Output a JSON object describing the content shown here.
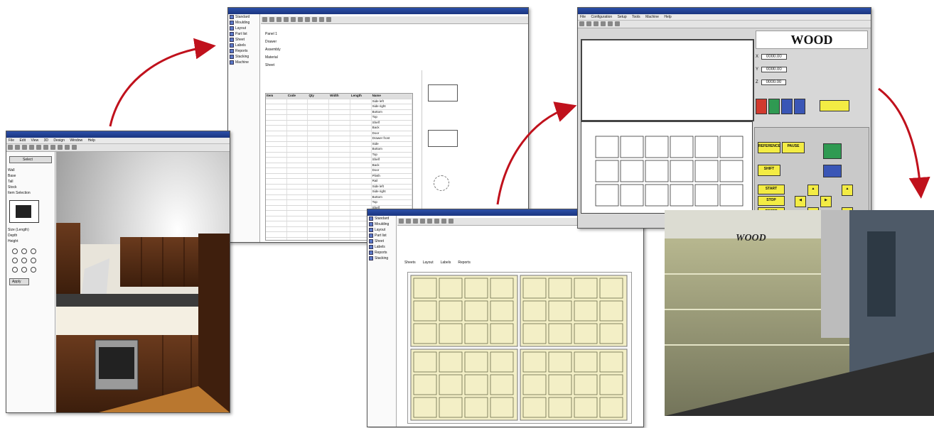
{
  "kitchen_window": {
    "menu": [
      "File",
      "Edit",
      "View",
      "3D",
      "Design",
      "Window",
      "Help"
    ],
    "side_labels": [
      "Wall",
      "Base",
      "Tall",
      "Stock",
      "Item Selection"
    ],
    "props": [
      "Size (Length)",
      "Depth",
      "Height"
    ],
    "buttons": [
      "Select",
      "Apply"
    ]
  },
  "parts_window": {
    "nav": [
      "Standard",
      "Moulding",
      "Layout",
      "Part list",
      "Sheet",
      "Labels",
      "Reports",
      "Stacking",
      "Machine"
    ],
    "fields": [
      "Panel 1",
      "Drawer",
      "Assembly",
      "Material",
      "Sheet"
    ],
    "table_headers": [
      "Item",
      "Code",
      "Qty",
      "Width",
      "Length",
      "Name"
    ],
    "row_names": [
      "Side left",
      "Side right",
      "Bottom",
      "Top",
      "Shelf",
      "Back",
      "Door",
      "Drawer front",
      "Side",
      "Bottom",
      "Top",
      "Shelf",
      "Back",
      "Door",
      "Plinth",
      "Rail",
      "Side left",
      "Side right",
      "Bottom",
      "Top",
      "Shelf",
      "Back",
      "Door",
      "Drawer front",
      "Side",
      "Bottom",
      "Top",
      "Shelf",
      "Back",
      "Door"
    ]
  },
  "nesting_window": {
    "nav": [
      "Standard",
      "Moulding",
      "Layout",
      "Part list",
      "Sheet",
      "Labels",
      "Reports",
      "Stacking"
    ],
    "tabs": [
      "Sheets",
      "Layout",
      "Labels",
      "Reports"
    ]
  },
  "machine_window": {
    "menu": [
      "File",
      "Configuration",
      "Setup",
      "Tools",
      "Machine",
      "Help"
    ],
    "logo": "WOOD",
    "axes": [
      "X",
      "Y",
      "Z"
    ],
    "axis_values": [
      "0000.00",
      "0000.00",
      "0000.00"
    ],
    "control_buttons": [
      "START",
      "STOP",
      "RESET",
      "REFERENCE",
      "PAUSE",
      "SHIFT"
    ]
  },
  "photo": {
    "brand": "WOOD"
  },
  "colors": {
    "title_blue": "#1a3480",
    "arrow_red": "#c0111c",
    "nest_sheet": "#f3efc6",
    "machine_yellow": "#f3ec44"
  }
}
